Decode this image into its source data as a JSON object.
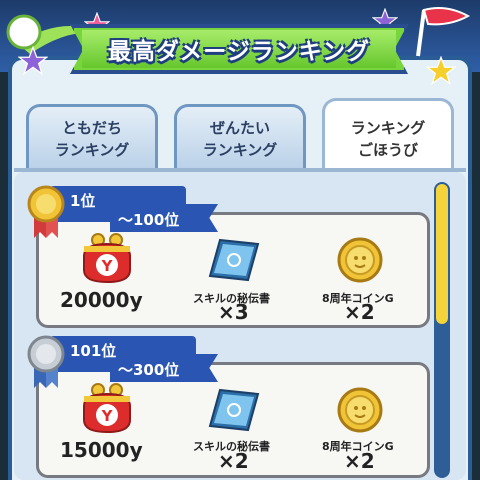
{
  "screen": {
    "title": "最高ダメージランキング"
  },
  "tabs": [
    {
      "label": "ともだち\nランキング",
      "active": false
    },
    {
      "label": "ぜんたい\nランキング",
      "active": false
    },
    {
      "label": "ランキング\nごほうび",
      "active": true
    }
  ],
  "ranks": [
    {
      "rank_from": "1位",
      "rank_to": "〜100位",
      "medal": "gold-medal-icon",
      "rewards": [
        {
          "icon": "coin-purse-icon",
          "name": "",
          "qty": "20000y"
        },
        {
          "icon": "skill-book-icon",
          "name": "スキルの秘伝書",
          "qty": "×3"
        },
        {
          "icon": "gold-coin-icon",
          "name": "8周年コインG",
          "qty": "×2"
        }
      ]
    },
    {
      "rank_from": "101位",
      "rank_to": "〜300位",
      "medal": "silver-medal-icon",
      "rewards": [
        {
          "icon": "coin-purse-icon",
          "name": "",
          "qty": "15000y"
        },
        {
          "icon": "skill-book-icon",
          "name": "スキルの秘伝書",
          "qty": "×2"
        },
        {
          "icon": "gold-coin-icon",
          "name": "8周年コインG",
          "qty": "×2"
        }
      ]
    }
  ],
  "colors": {
    "title_green": "#78d63c",
    "ribbon_blue": "#2b55b3",
    "scroll_thumb": "#f5d33b",
    "panel_border": "#2a5c95"
  },
  "scroll": {
    "position": 0.0
  }
}
